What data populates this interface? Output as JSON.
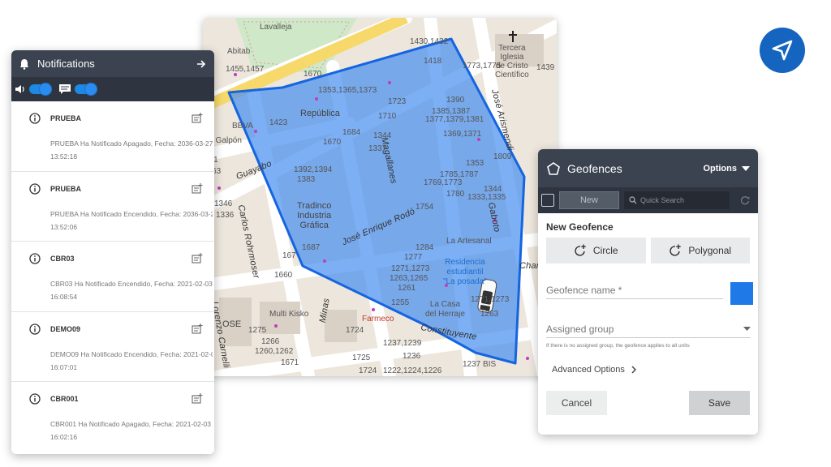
{
  "map": {
    "streets": {
      "guayabo": "Guayabo",
      "carlos_rohrmoser": "Carlos Rohrmoser",
      "lorenzo": "Lorenzo Carnelli",
      "jose_enrique_rodo": "José Enrique Rodó",
      "magallanes": "Magallanes",
      "gaboto": "Gaboto",
      "jose_arismendi": "José Arismendi",
      "minas": "Minas",
      "constituyente": "Constituyente",
      "lavalleja": "Lavalleja",
      "charr": "Charr"
    },
    "places": {
      "republica": "República",
      "tradinco": "Tradinco\nIndustria\nGráfica",
      "abitab": "Abitab",
      "galpon": "El Galpón",
      "bbva": "BBVA",
      "tercera_iglesia": "Tercera\nIglesia\nde Cristo\nCientífico",
      "la_artesanal": "La Artesanal",
      "residencia": "Residencia\nestudiantil\n\"La posada\"",
      "la_casa_herraje": "La Casa\ndel Herraje",
      "farmeco": "Farmeco",
      "multi_kisko": "Multi Kisko",
      "ose": "OSE"
    },
    "numbers": [
      "1430,1432",
      "1418",
      "1773,1775",
      "1439",
      "1455,1457",
      "1670",
      "1353,1365,1373",
      "1423",
      "1723",
      "1390",
      "1385,1387",
      "1377,1379,1381",
      "1710",
      "1369,1371",
      "1684",
      "1344",
      "1337",
      "1670",
      "1392,1394",
      "1383",
      "1809",
      "1353",
      "1785,1787",
      "1769,1773",
      "1780",
      "1344",
      "1333,1335",
      "1346",
      "1336",
      "1754",
      "1687",
      "1284",
      "1277",
      "1271,1273",
      "1263,1265",
      "1261",
      "1255",
      "1271,1273",
      "1263",
      "1660",
      "1275",
      "1266",
      "1260,1262",
      "1724",
      "1725",
      "1237,1239",
      "1236",
      "1671",
      "1724",
      "1222,1224,1226",
      "1237 BIS",
      "1363",
      "371",
      "167"
    ]
  },
  "notifications": {
    "title": "Notifications",
    "items": [
      {
        "name": "PRUEBA",
        "message": "PRUEBA Ha Notificado Apagado, Fecha: 2036-03-27",
        "time": "13:52:18"
      },
      {
        "name": "PRUEBA",
        "message": "PRUEBA Ha Notificado Encendido, Fecha: 2036-03-2",
        "time": "13:52:06"
      },
      {
        "name": "CBR03",
        "message": "CBR03 Ha Notificado Encendido, Fecha: 2021-02-03",
        "time": "16:08:54"
      },
      {
        "name": "DEMO09",
        "message": "DEMO09 Ha Notificado Encendido, Fecha: 2021-02-0",
        "time": "16:07:01"
      },
      {
        "name": "CBR001",
        "message": "CBR001 Ha Notificado Apagado, Fecha: 2021-02-03",
        "time": "16:02:16"
      }
    ]
  },
  "geofences": {
    "title": "Geofences",
    "options_label": "Options",
    "new_label": "New",
    "search_placeholder": "Quick Search",
    "section_title": "New Geofence",
    "circle_label": "Circle",
    "polygonal_label": "Polygonal",
    "name_placeholder": "Geofence name *",
    "group_placeholder": "Assigned group",
    "hint": "If there is no assigned group, the geofence applies to all units",
    "advanced_label": "Advanced Options",
    "cancel_label": "Cancel",
    "save_label": "Save",
    "swatch_color": "#1f7ae8"
  },
  "colors": {
    "header": "#3b4350",
    "accent": "#1e88e5",
    "geofence_fill": "#4a90f0",
    "geofence_stroke": "#1565e0"
  }
}
